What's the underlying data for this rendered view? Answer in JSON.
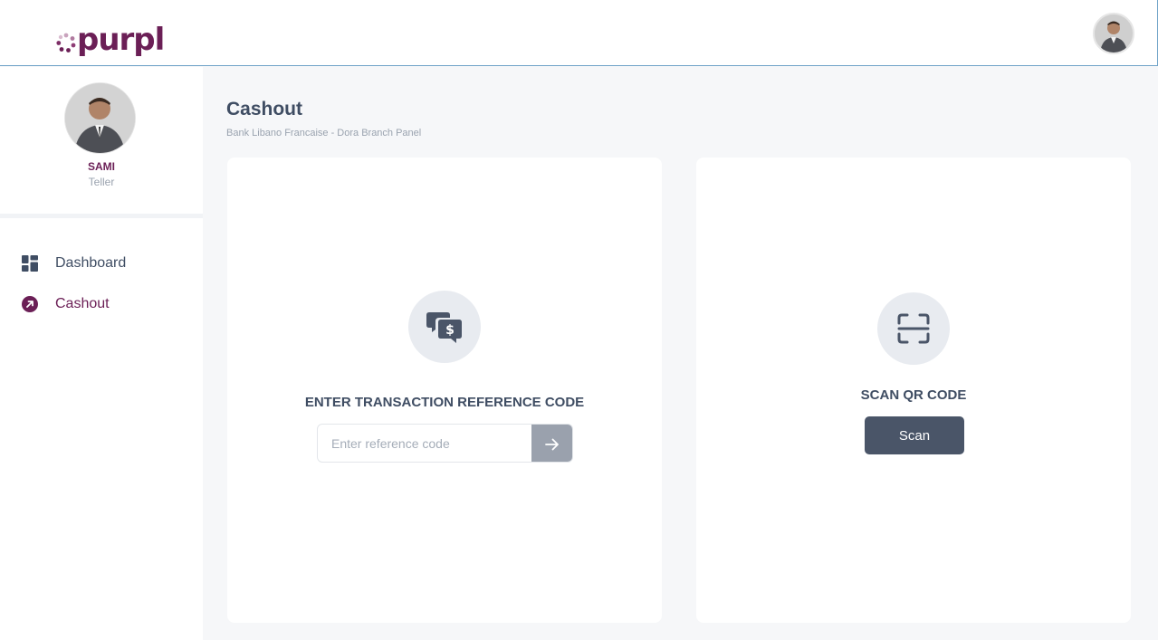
{
  "app": {
    "brand": "purpl",
    "brand_color": "#6b1f56",
    "accent_border": "#6fa3c8"
  },
  "header": {
    "avatar_icon": "user-avatar"
  },
  "sidebar": {
    "profile": {
      "name": "SAMI",
      "role": "Teller"
    },
    "items": [
      {
        "label": "Dashboard",
        "icon": "dashboard-grid-icon",
        "active": false
      },
      {
        "label": "Cashout",
        "icon": "arrow-up-right-circle-icon",
        "active": true
      }
    ]
  },
  "page": {
    "title": "Cashout",
    "subtitle": "Bank Libano Francaise - Dora Branch Panel"
  },
  "reference_card": {
    "icon": "chat-dollar-icon",
    "heading": "ENTER TRANSACTION REFERENCE CODE",
    "input_value": "",
    "input_placeholder": "Enter reference code",
    "submit_icon": "arrow-right-icon"
  },
  "scan_card": {
    "icon": "qr-scan-icon",
    "heading": "SCAN QR CODE",
    "button_label": "Scan"
  }
}
